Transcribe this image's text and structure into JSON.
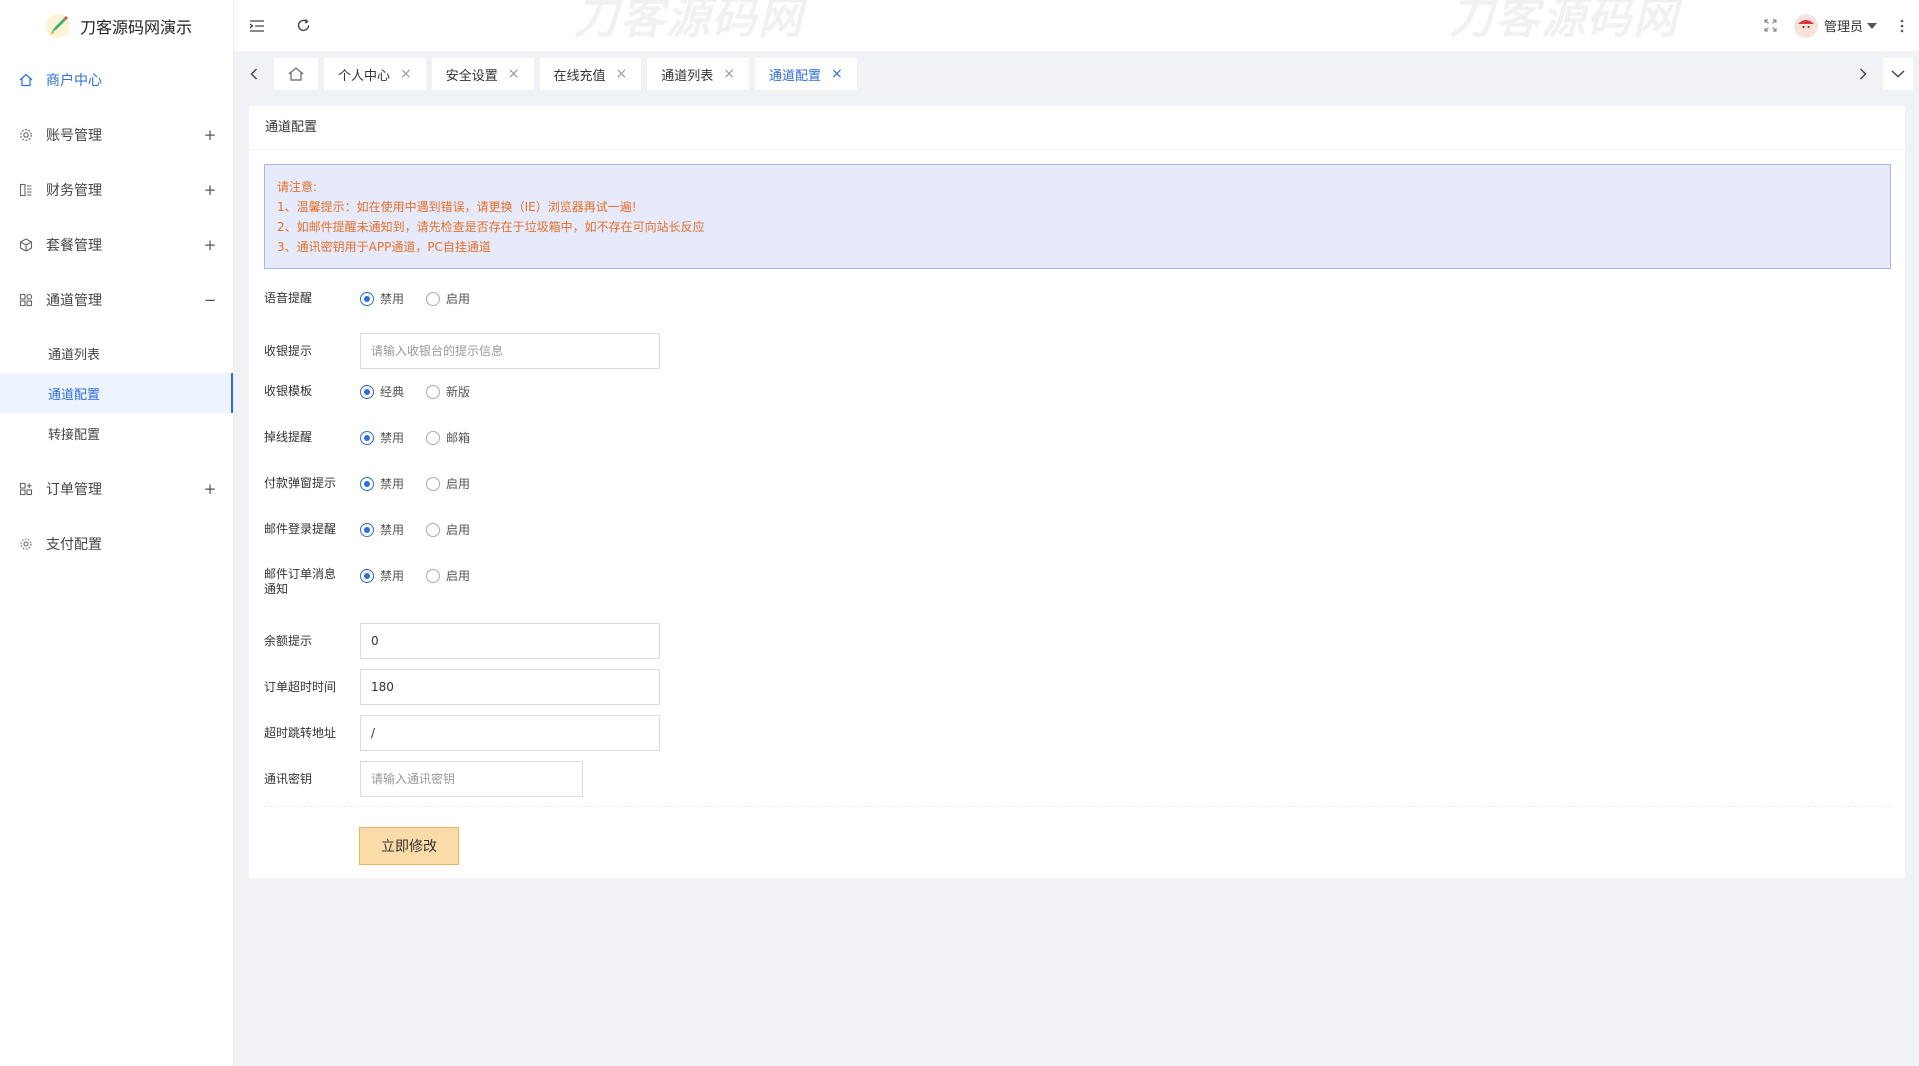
{
  "app": {
    "title": "刀客源码网演示"
  },
  "watermarks": [
    "刀客源码网",
    "刀客源码网"
  ],
  "sidebar": {
    "items": [
      {
        "label": "商户中心",
        "icon": "home-icon",
        "active": true
      },
      {
        "label": "账号管理",
        "icon": "gear-icon",
        "toggle": "+"
      },
      {
        "label": "财务管理",
        "icon": "finance-icon",
        "toggle": "+"
      },
      {
        "label": "套餐管理",
        "icon": "package-icon",
        "toggle": "+"
      },
      {
        "label": "通道管理",
        "icon": "channel-icon",
        "toggle": "−"
      },
      {
        "label": "订单管理",
        "icon": "order-icon",
        "toggle": "+"
      },
      {
        "label": "支付配置",
        "icon": "settings-icon"
      }
    ],
    "subitems": [
      {
        "label": "通道列表"
      },
      {
        "label": "通道配置",
        "active": true
      },
      {
        "label": "转接配置"
      }
    ]
  },
  "header": {
    "user_name": "管理员"
  },
  "tabs": [
    {
      "label": "个人中心"
    },
    {
      "label": "安全设置"
    },
    {
      "label": "在线充值"
    },
    {
      "label": "通道列表"
    },
    {
      "label": "通道配置",
      "active": true
    }
  ],
  "panel": {
    "title": "通道配置",
    "notice": {
      "heading": "请注意:",
      "lines": [
        "1、温馨提示：如在使用中遇到错误，请更换（IE）浏览器再试一遍!",
        "2、如邮件提醒未通知到，请先检查是否存在于垃圾箱中，如不存在可向站长反应",
        "3、通讯密钥用于APP通道，PC自挂通道"
      ]
    },
    "form": {
      "voice_remind": {
        "label": "语音提醒",
        "options": [
          "禁用",
          "启用"
        ],
        "selected": "禁用"
      },
      "cashier_tip": {
        "label": "收银提示",
        "value": "",
        "placeholder": "请输入收银台的提示信息"
      },
      "cashier_template": {
        "label": "收银模板",
        "options": [
          "经典",
          "新版"
        ],
        "selected": "经典"
      },
      "offline_remind": {
        "label": "掉线提醒",
        "options": [
          "禁用",
          "邮箱"
        ],
        "selected": "禁用"
      },
      "payment_popup": {
        "label": "付款弹窗提示",
        "options": [
          "禁用",
          "启用"
        ],
        "selected": "禁用"
      },
      "mail_login_remind": {
        "label": "邮件登录提醒",
        "options": [
          "禁用",
          "启用"
        ],
        "selected": "禁用"
      },
      "mail_order_notify": {
        "label": "邮件订单消息通知",
        "options": [
          "禁用",
          "启用"
        ],
        "selected": "禁用"
      },
      "balance_tip": {
        "label": "余额提示",
        "value": "0",
        "placeholder": ""
      },
      "order_timeout": {
        "label": "订单超时时间",
        "value": "180",
        "placeholder": ""
      },
      "timeout_redirect": {
        "label": "超时跳转地址",
        "value": "/",
        "placeholder": ""
      },
      "comm_key": {
        "label": "通讯密钥",
        "value": "",
        "placeholder": "请输入通讯密钥"
      },
      "submit_label": "立即修改"
    }
  },
  "colors": {
    "accent": "#2d6ed8",
    "notice_bg": "#e7eafb",
    "notice_text": "#e2702a",
    "submit_bg": "#fbdca8"
  }
}
